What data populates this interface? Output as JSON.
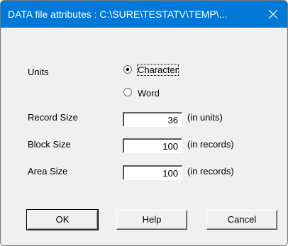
{
  "window": {
    "title": "DATA file attributes : C:\\SURE\\TESTATV\\TEMP\\...",
    "close_icon": "close-icon"
  },
  "units": {
    "label": "Units",
    "options": [
      {
        "label": "Character",
        "selected": true
      },
      {
        "label": "Word",
        "selected": false
      }
    ]
  },
  "fields": {
    "record_size": {
      "label": "Record Size",
      "value": "36",
      "unit": "(in units)"
    },
    "block_size": {
      "label": "Block Size",
      "value": "100",
      "unit": "(in records)"
    },
    "area_size": {
      "label": "Area Size",
      "value": "100",
      "unit": "(in records)"
    }
  },
  "buttons": {
    "ok": "OK",
    "help": "Help",
    "cancel": "Cancel"
  },
  "colors": {
    "titlebar": "#0078d7",
    "dialog_bg": "#f0f0f0"
  }
}
